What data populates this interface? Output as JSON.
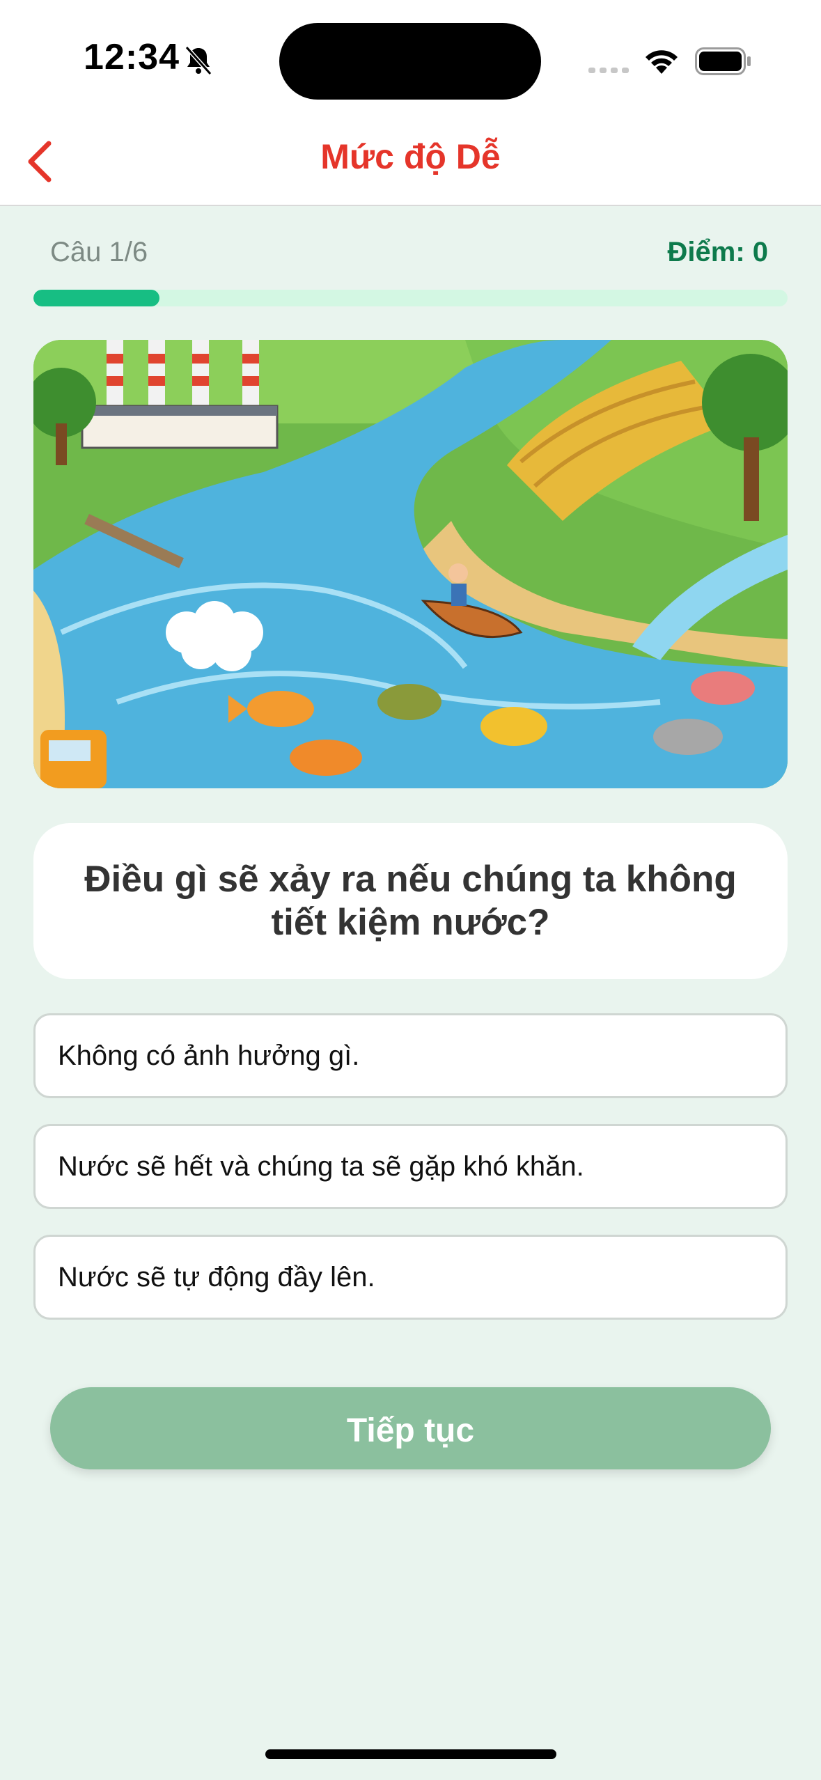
{
  "status_bar": {
    "time": "12:34"
  },
  "nav": {
    "title": "Mức độ Dễ",
    "back_icon": "chevron-left-icon"
  },
  "progress": {
    "question_label": "Câu 1/6",
    "score_label": "Điểm: 0",
    "current": 1,
    "total": 6,
    "fill_fraction": 0.1667
  },
  "question": {
    "text": "Điều gì sẽ xảy ra nếu chúng ta không tiết kiệm nước?"
  },
  "answers": [
    {
      "label": "Không có ảnh hưởng gì."
    },
    {
      "label": "Nước sẽ hết và chúng ta sẽ gặp khó khăn."
    },
    {
      "label": "Nước sẽ tự động đầy lên."
    }
  ],
  "continue_button": {
    "label": "Tiếp tục"
  },
  "colors": {
    "accent_red": "#e5352a",
    "score_green": "#0e7a4c",
    "progress_fill": "#17be83",
    "progress_track": "#d3f7e3",
    "button_green": "#8bc09e",
    "background": "#e9f4ee"
  }
}
